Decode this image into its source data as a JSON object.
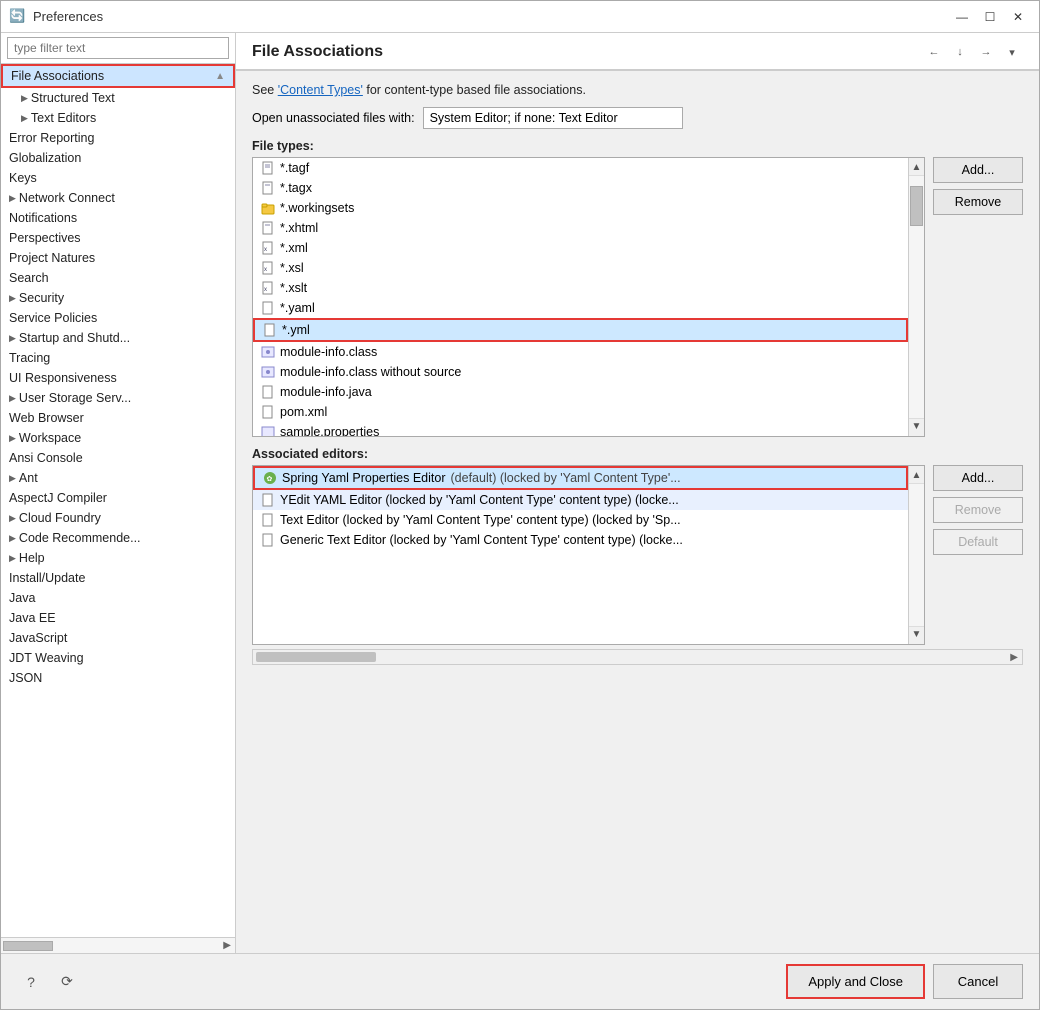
{
  "window": {
    "title": "Preferences",
    "icon": "🔄"
  },
  "sidebar": {
    "filter_placeholder": "type filter text",
    "items": [
      {
        "id": "file-associations",
        "label": "File Associations",
        "indent": 0,
        "active": true,
        "has_expand": false
      },
      {
        "id": "structured-text",
        "label": "Structured Text",
        "indent": 1,
        "has_expand": true
      },
      {
        "id": "text-editors",
        "label": "Text Editors",
        "indent": 1,
        "has_expand": true
      },
      {
        "id": "error-reporting",
        "label": "Error Reporting",
        "indent": 0,
        "has_expand": false
      },
      {
        "id": "globalization",
        "label": "Globalization",
        "indent": 0,
        "has_expand": false
      },
      {
        "id": "keys",
        "label": "Keys",
        "indent": 0,
        "has_expand": false
      },
      {
        "id": "network-connect",
        "label": "Network Connect",
        "indent": 0,
        "has_expand": true
      },
      {
        "id": "notifications",
        "label": "Notifications",
        "indent": 0,
        "has_expand": false
      },
      {
        "id": "perspectives",
        "label": "Perspectives",
        "indent": 0,
        "has_expand": false
      },
      {
        "id": "project-natures",
        "label": "Project Natures",
        "indent": 0,
        "has_expand": false
      },
      {
        "id": "search",
        "label": "Search",
        "indent": 0,
        "has_expand": false
      },
      {
        "id": "security",
        "label": "Security",
        "indent": 0,
        "has_expand": true
      },
      {
        "id": "service-policies",
        "label": "Service Policies",
        "indent": 0,
        "has_expand": false
      },
      {
        "id": "startup-and-shut",
        "label": "Startup and Shutd...",
        "indent": 0,
        "has_expand": true
      },
      {
        "id": "tracing",
        "label": "Tracing",
        "indent": 0,
        "has_expand": false
      },
      {
        "id": "ui-responsiveness",
        "label": "UI Responsiveness",
        "indent": 0,
        "has_expand": false
      },
      {
        "id": "user-storage-serv",
        "label": "User Storage Serv...",
        "indent": 0,
        "has_expand": true
      },
      {
        "id": "web-browser",
        "label": "Web Browser",
        "indent": 0,
        "has_expand": false
      },
      {
        "id": "workspace",
        "label": "Workspace",
        "indent": 0,
        "has_expand": true
      },
      {
        "id": "ansi-console",
        "label": "Ansi Console",
        "indent": 0,
        "has_expand": false
      },
      {
        "id": "ant",
        "label": "Ant",
        "indent": 0,
        "has_expand": true
      },
      {
        "id": "aspectj-compiler",
        "label": "AspectJ Compiler",
        "indent": 0,
        "has_expand": false
      },
      {
        "id": "cloud-foundry",
        "label": "Cloud Foundry",
        "indent": 0,
        "has_expand": true
      },
      {
        "id": "code-recommende",
        "label": "Code Recommende...",
        "indent": 0,
        "has_expand": true
      },
      {
        "id": "help",
        "label": "Help",
        "indent": 0,
        "has_expand": true
      },
      {
        "id": "install-update",
        "label": "Install/Update",
        "indent": 0,
        "has_expand": false
      },
      {
        "id": "java",
        "label": "Java",
        "indent": 0,
        "has_expand": false
      },
      {
        "id": "java-ee",
        "label": "Java EE",
        "indent": 0,
        "has_expand": false
      },
      {
        "id": "javascript",
        "label": "JavaScript",
        "indent": 0,
        "has_expand": false
      },
      {
        "id": "jdt-weaving",
        "label": "JDT Weaving",
        "indent": 0,
        "has_expand": false
      },
      {
        "id": "json",
        "label": "JSON",
        "indent": 0,
        "has_expand": false
      }
    ]
  },
  "panel": {
    "title": "File Associations",
    "info_text": "See ",
    "info_link": "'Content Types'",
    "info_suffix": " for content-type based file associations.",
    "open_unassoc_label": "Open unassociated files with:",
    "open_unassoc_value": "System Editor; if none: Text Editor",
    "file_types_label": "File types:",
    "add_label_1": "Add...",
    "remove_label_1": "Remove",
    "associated_editors_label": "Associated editors:",
    "add_label_2": "Add...",
    "remove_label_2": "Remove",
    "default_label": "Default"
  },
  "file_types": [
    {
      "icon": "file",
      "name": "*.tagf"
    },
    {
      "icon": "file",
      "name": "*.tagx"
    },
    {
      "icon": "folder",
      "name": "*.workingsets"
    },
    {
      "icon": "file",
      "name": "*.xhtml"
    },
    {
      "icon": "file",
      "name": "*.xml"
    },
    {
      "icon": "file",
      "name": "*.xsl"
    },
    {
      "icon": "file",
      "name": "*.xslt"
    },
    {
      "icon": "file",
      "name": "*.yaml"
    },
    {
      "icon": "file",
      "name": "*.yml",
      "selected": true
    },
    {
      "icon": "module",
      "name": "module-info.class"
    },
    {
      "icon": "module",
      "name": "module-info.class without source"
    },
    {
      "icon": "file",
      "name": "module-info.java"
    },
    {
      "icon": "file",
      "name": "pom.xml"
    },
    {
      "icon": "module",
      "name": "sample.properties"
    }
  ],
  "associated_editors": [
    {
      "icon": "spring",
      "name": "Spring Yaml Properties Editor",
      "suffix": " (default) (locked by 'Yaml Content Type'...",
      "selected": true
    },
    {
      "icon": "file",
      "name": "YEdit YAML Editor (locked by 'Yaml Content Type' content type) (locke...",
      "selected": false
    },
    {
      "icon": "file",
      "name": "Text Editor (locked by 'Yaml Content Type' content type) (locked by 'Sp...",
      "selected": false
    },
    {
      "icon": "file",
      "name": "Generic Text Editor (locked by 'Yaml Content Type' content type) (locke...",
      "selected": false
    }
  ],
  "footer": {
    "help_icon": "?",
    "restore_icon": "⟳",
    "apply_close_label": "Apply and Close",
    "cancel_label": "Cancel"
  }
}
